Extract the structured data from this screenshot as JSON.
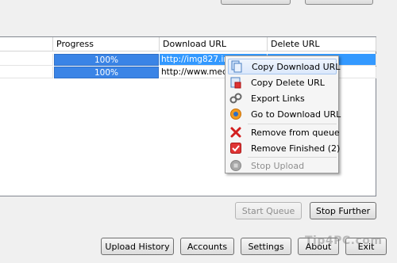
{
  "table": {
    "columns": [
      "Progress",
      "Download URL",
      "Delete URL"
    ],
    "rows": [
      {
        "progress": "100%",
        "download_url": "http://img827.ima",
        "delete_url": ""
      },
      {
        "progress": "100%",
        "download_url": "http://www.media",
        "delete_url": ""
      }
    ]
  },
  "context_menu": {
    "items": [
      {
        "label": "Copy Download URL",
        "icon": "copy-icon"
      },
      {
        "label": "Copy Delete URL",
        "icon": "copy-delete-icon"
      },
      {
        "label": "Export Links",
        "icon": "links-icon"
      },
      {
        "label": "Go to Download URL",
        "icon": "browser-icon"
      },
      {
        "label": "Remove from queue",
        "icon": "red-x-icon"
      },
      {
        "label": "Remove Finished (2)",
        "icon": "red-check-icon"
      },
      {
        "label": "Stop Upload",
        "icon": "stop-icon"
      }
    ]
  },
  "queue_buttons": {
    "start": "Start Queue",
    "stop": "Stop Further"
  },
  "bottom_buttons": {
    "upload_history": "Upload History",
    "accounts": "Accounts",
    "settings": "Settings",
    "about": "About",
    "exit": "Exit"
  },
  "watermark": "Tip4PC.com",
  "colors": {
    "progress_fill": "#3a84e6",
    "selection": "#3399ff",
    "menu_highlight": "#dbe8fb"
  }
}
